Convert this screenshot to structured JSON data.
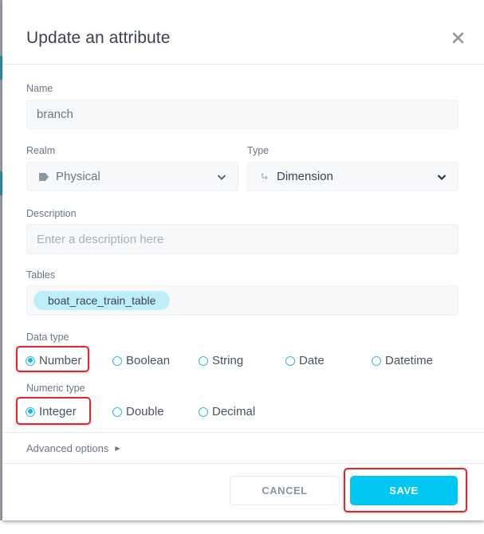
{
  "dialog": {
    "title": "Update an attribute",
    "close_icon": "close-icon"
  },
  "form": {
    "name": {
      "label": "Name",
      "value": "branch"
    },
    "realm": {
      "label": "Realm",
      "value": "Physical",
      "icon": "tag-icon"
    },
    "type": {
      "label": "Type",
      "value": "Dimension",
      "icon": "dimension-arrows-icon"
    },
    "description": {
      "label": "Description",
      "value": "",
      "placeholder": "Enter a description here"
    },
    "tables": {
      "label": "Tables",
      "chips": [
        "boat_race_train_table"
      ]
    },
    "data_type": {
      "label": "Data type",
      "options": [
        "Number",
        "Boolean",
        "String",
        "Date",
        "Datetime"
      ],
      "selected": "Number"
    },
    "numeric_type": {
      "label": "Numeric type",
      "options": [
        "Integer",
        "Double",
        "Decimal"
      ],
      "selected": "Integer"
    },
    "advanced_options": "Advanced options"
  },
  "footer": {
    "cancel_label": "CANCEL",
    "save_label": "SAVE"
  },
  "colors": {
    "accent": "#00c7f2",
    "highlight": "#e0262d",
    "chip": "#bdeefa"
  }
}
